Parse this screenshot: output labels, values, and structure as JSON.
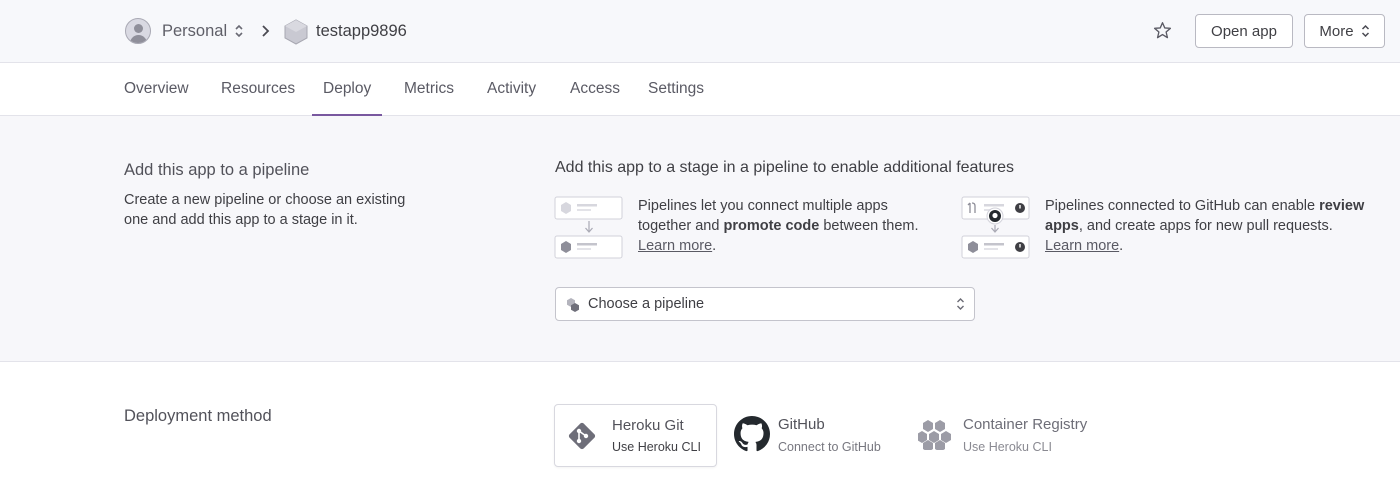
{
  "header": {
    "account": "Personal",
    "app_name": "testapp9896",
    "open_app_label": "Open app",
    "more_label": "More"
  },
  "tabs": [
    {
      "label": "Overview"
    },
    {
      "label": "Resources"
    },
    {
      "label": "Deploy",
      "active": true
    },
    {
      "label": "Metrics"
    },
    {
      "label": "Activity"
    },
    {
      "label": "Access"
    },
    {
      "label": "Settings"
    }
  ],
  "pipeline": {
    "title": "Add this app to a pipeline",
    "description_line1": "Create a new pipeline or choose an existing",
    "description_line2": "one and add this app to a stage in it.",
    "heading": "Add this app to a stage in a pipeline to enable additional features",
    "feature1": {
      "line1": "Pipelines let you connect multiple apps",
      "line2_pre": "together and ",
      "line2_bold": "promote code",
      "line2_post": " between them.",
      "link": "Learn more",
      "link_suffix": "."
    },
    "feature2": {
      "line1_pre": "Pipelines connected to GitHub can enable ",
      "line1_bold": "review",
      "line2_bold": "apps",
      "line2_post": ", and create apps for new pull requests.",
      "link": "Learn more",
      "link_suffix": "."
    },
    "select_label": "Choose a pipeline"
  },
  "deployment": {
    "title": "Deployment method",
    "methods": [
      {
        "name": "Heroku Git",
        "sub": "Use Heroku CLI",
        "icon": "git-icon",
        "selected": true
      },
      {
        "name": "GitHub",
        "sub": "Connect to GitHub",
        "icon": "github-icon"
      },
      {
        "name": "Container Registry",
        "sub": "Use Heroku CLI",
        "icon": "container-registry-icon"
      }
    ]
  },
  "colors": {
    "accent": "#79589f",
    "text": "#3f3f44",
    "header_bg": "#f7f8fb",
    "section_bg": "#f7f7fa",
    "github_black": "#24292e"
  }
}
